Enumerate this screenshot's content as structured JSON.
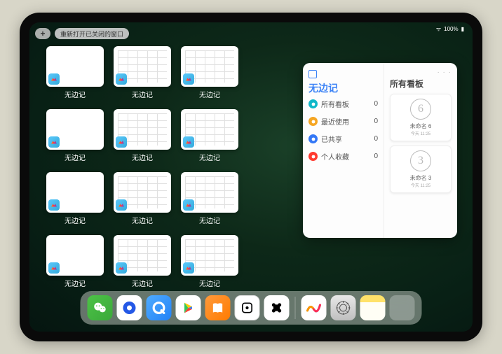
{
  "statusbar": {
    "wifi": "ᯤ",
    "battery_label": "100%",
    "battery": "▮"
  },
  "topbar": {
    "plus": "+",
    "reopen_label": "重新打开已关闭的窗口"
  },
  "window_label": "无边记",
  "grid": [
    {
      "style": "blank"
    },
    {
      "style": "table"
    },
    {
      "style": "table"
    },
    null,
    {
      "style": "blank"
    },
    {
      "style": "table"
    },
    {
      "style": "table"
    },
    null,
    {
      "style": "blank"
    },
    {
      "style": "table"
    },
    {
      "style": "table"
    },
    null,
    {
      "style": "blank"
    },
    {
      "style": "table"
    },
    {
      "style": "table"
    },
    null
  ],
  "panel": {
    "left_title": "无边记",
    "right_title": "所有看板",
    "menu_dots": "· · ·",
    "nav": [
      {
        "label": "所有看板",
        "count": "0",
        "color": "#10b8c9"
      },
      {
        "label": "最近使用",
        "count": "0",
        "color": "#f5a623"
      },
      {
        "label": "已共享",
        "count": "0",
        "color": "#3478f6"
      },
      {
        "label": "个人收藏",
        "count": "0",
        "color": "#ff3b30"
      }
    ],
    "boards": [
      {
        "glyph": "6",
        "label": "未命名 6",
        "sub": "今天 11:25"
      },
      {
        "glyph": "3",
        "label": "未命名 3",
        "sub": "今天 11:25"
      }
    ]
  },
  "dock": {
    "items": [
      {
        "name": "wechat"
      },
      {
        "name": "qbrowser"
      },
      {
        "name": "qq"
      },
      {
        "name": "play"
      },
      {
        "name": "books"
      },
      {
        "name": "dice"
      },
      {
        "name": "graph"
      }
    ],
    "recent": [
      {
        "name": "freeform"
      },
      {
        "name": "settings"
      },
      {
        "name": "notes"
      },
      {
        "name": "app-library"
      }
    ]
  }
}
